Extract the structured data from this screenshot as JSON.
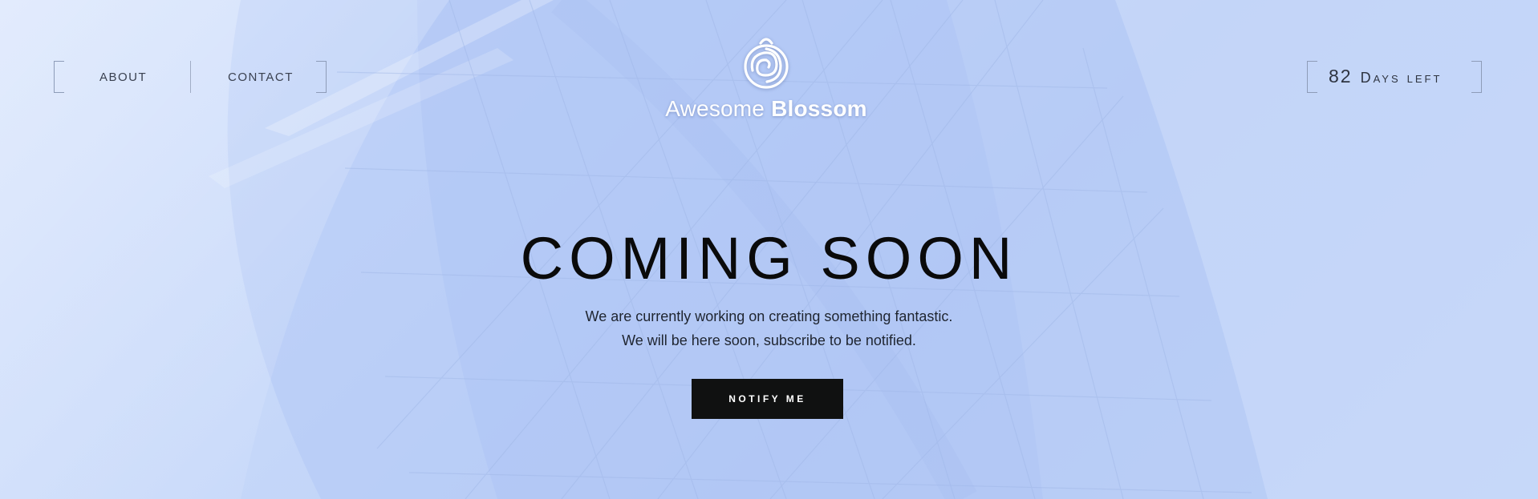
{
  "nav": {
    "about_label": "ABOUT",
    "contact_label": "CONTACT"
  },
  "countdown": {
    "days": "82",
    "label": "Days left"
  },
  "logo": {
    "icon": "rose-flower-icon",
    "text_light": "Awesome",
    "text_bold": "Blossom"
  },
  "hero": {
    "title": "COMING SOON",
    "line1": "We are currently working on creating something fantastic.",
    "line2": "We will be here soon, subscribe to be notified.",
    "button_label": "NOTIFY ME"
  },
  "colors": {
    "background": "#c5d7f9",
    "button": "#101111",
    "title": "#0a0a0a"
  }
}
